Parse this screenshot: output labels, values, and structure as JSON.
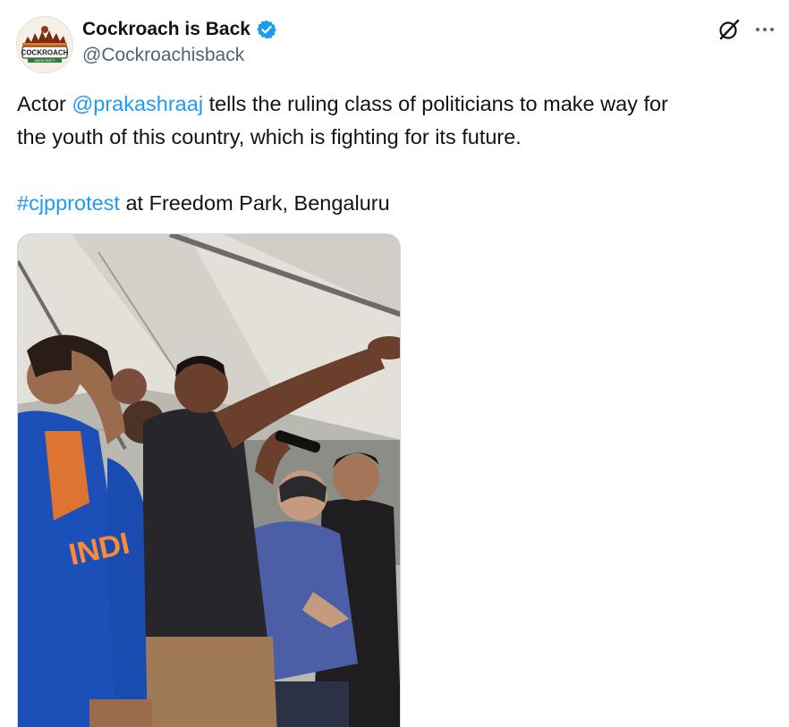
{
  "author": {
    "display_name": "Cockroach is Back",
    "handle": "@Cockroachisback",
    "avatar_text": "COCKROACH",
    "avatar_subtext": "JANTA PARTY",
    "verified": true
  },
  "actions": {
    "grok_icon": "grok-icon",
    "more_icon": "more-icon"
  },
  "tweet": {
    "prefix": "Actor ",
    "mention": "@prakashraaj",
    "line1_rest": " tells the ruling class of politicians to make way for",
    "line2": "the youth of this country, which is fighting for its future.",
    "hashtag": "#cjpprotest",
    "location_text": " at Freedom Park, Bengaluru"
  },
  "media": {
    "kind": "video",
    "jersey_text": "INDI"
  },
  "colors": {
    "link": "#1d9bf0",
    "verified_badge": "#1d9bf0",
    "text": "#0f1419",
    "secondary": "#536471"
  }
}
